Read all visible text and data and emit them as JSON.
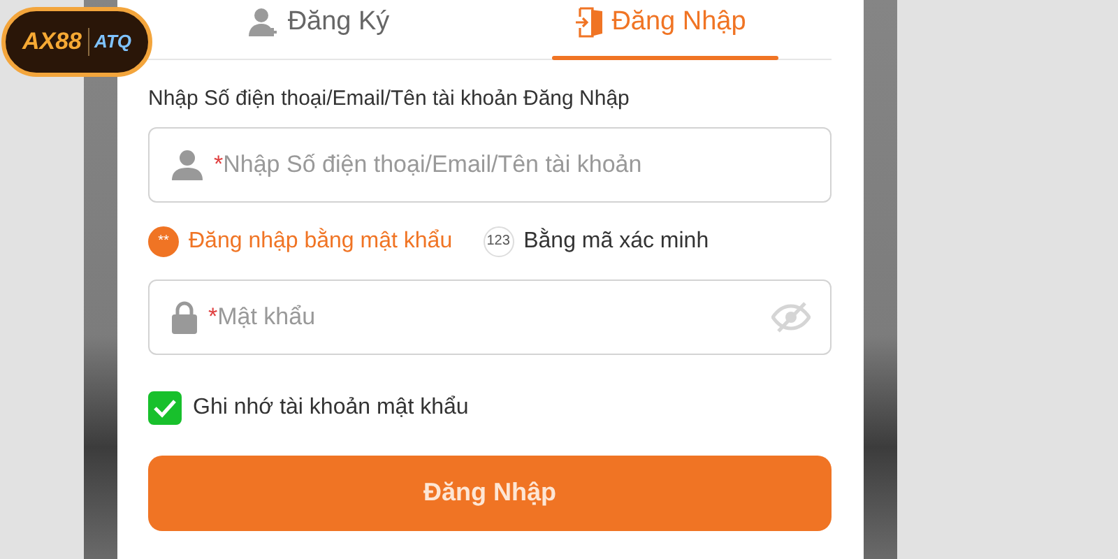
{
  "logo": {
    "brand": "AX88",
    "partner": "ATQ"
  },
  "tabs": [
    {
      "label": "Đăng Ký",
      "kind": "register",
      "selected": false
    },
    {
      "label": "Đăng Nhập",
      "kind": "login",
      "selected": true
    }
  ],
  "account_label": "Nhập Số điện thoại/Email/Tên tài khoản Đăng Nhập",
  "account_field": {
    "required_mark": "*",
    "placeholder": "Nhập Số điện thoại/Email/Tên tài khoản"
  },
  "login_methods": [
    {
      "label": "Đăng nhập bằng mật khẩu",
      "badge": "**",
      "selected": true
    },
    {
      "label": "Bằng mã xác minh",
      "badge": "123",
      "selected": false
    }
  ],
  "password_field": {
    "required_mark": "*",
    "placeholder": "Mật khẩu"
  },
  "remember": {
    "label": "Ghi nhớ tài khoản mật khẩu",
    "checked": true
  },
  "submit": "Đăng Nhập"
}
